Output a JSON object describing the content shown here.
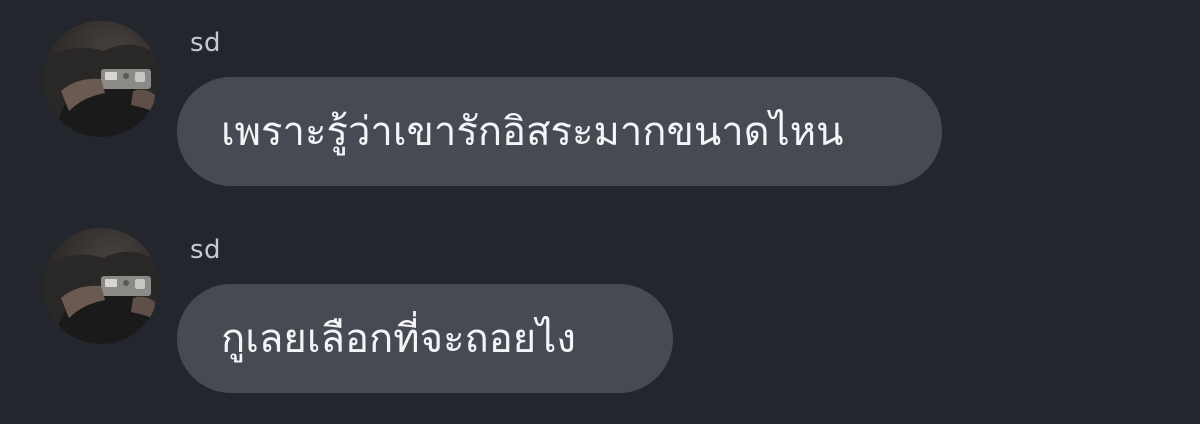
{
  "messages": [
    {
      "sender": "sd",
      "text": "เพราะรู้ว่าเขารักอิสระมากขนาดไหน",
      "avatar_icon": "user-avatar-photo"
    },
    {
      "sender": "sd",
      "text": "กูเลยเลือกที่จะถอยไง",
      "avatar_icon": "user-avatar-photo"
    }
  ],
  "colors": {
    "background": "#24262e",
    "bubble": "#464a53",
    "text": "#f4f4f6",
    "sender": "#c9cad0"
  }
}
